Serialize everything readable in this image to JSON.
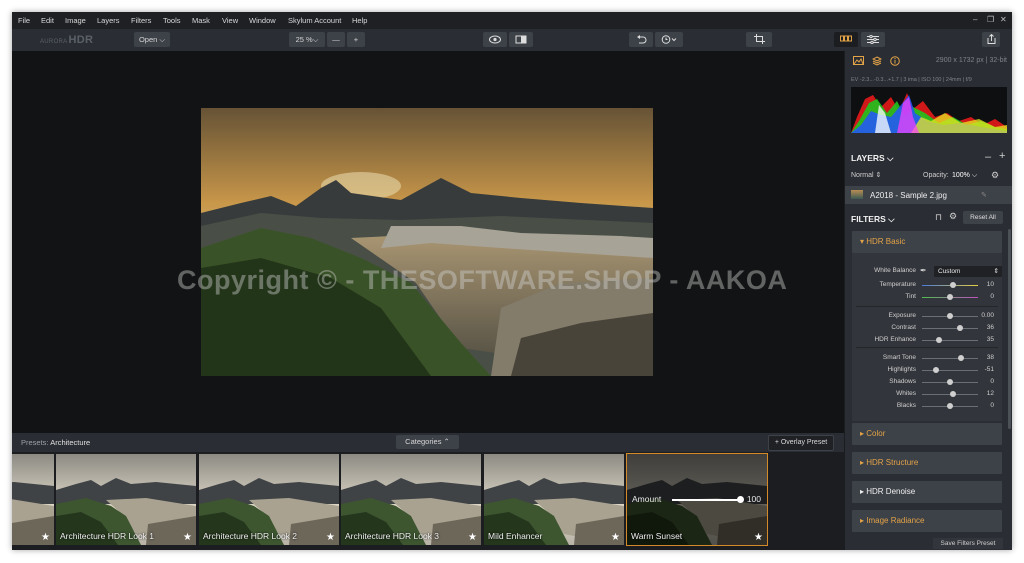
{
  "menubar": {
    "items": [
      "File",
      "Edit",
      "Image",
      "Layers",
      "Filters",
      "Tools",
      "Mask",
      "View",
      "Window",
      "Skylum Account",
      "Help"
    ],
    "window_controls": {
      "minimize": "–",
      "restore": "❐",
      "close": "✕"
    }
  },
  "toolbar": {
    "logo_prefix": "AURORA",
    "logo_main": "HDR",
    "open_label": "Open ⌵",
    "zoom_value": "25 %⌵",
    "zoom_out": "—",
    "zoom_in": "+",
    "icons": [
      "eye-icon",
      "compare-icon",
      "undo-icon",
      "history-icon",
      "crop-icon",
      "presets-view-icon",
      "adjustments-view-icon",
      "share-icon"
    ]
  },
  "canvas": {
    "watermark": "Copyright © - THESOFTWARE.SHOP - AAKOA"
  },
  "presets": {
    "label_prefix": "Presets:",
    "category": "Architecture",
    "categories_button": "Categories ⌃",
    "overlay_button": "+ Overlay Preset",
    "items": [
      {
        "label": ""
      },
      {
        "label": "Architecture HDR Look 1"
      },
      {
        "label": "Architecture HDR Look 2"
      },
      {
        "label": "Architecture HDR Look 3"
      },
      {
        "label": "Mild Enhancer"
      },
      {
        "label": "Warm Sunset"
      }
    ],
    "amount_label": "Amount",
    "amount_value": "100",
    "amount_fraction": 1.0
  },
  "panel": {
    "image_size": "2900 x 1732 px  |  32-bit",
    "exif": "EV -2.3...-0.3...+1.7  |  3 ima  |  ISO 100  |  24mm  |  f/9",
    "layers_title": "LAYERS ⌵",
    "blend_mode": "Normal ⇕",
    "opacity_label": "Opacity:",
    "opacity_value": "100% ⌵",
    "layer_name": "A2018 - Sample 2.jpg",
    "filters_title": "FILTERS ⌵",
    "reset_all": "Reset All",
    "hdr_basic": "HDR Basic",
    "white_balance_label": "White Balance",
    "white_balance_value": "Custom",
    "sliders_a": [
      {
        "label": "Temperature",
        "value": "10",
        "pos": 0.55
      },
      {
        "label": "Tint",
        "value": "0",
        "pos": 0.5
      }
    ],
    "sliders_b": [
      {
        "label": "Exposure",
        "value": "0.00",
        "pos": 0.5
      },
      {
        "label": "Contrast",
        "value": "36",
        "pos": 0.68
      },
      {
        "label": "HDR Enhance",
        "value": "35",
        "pos": 0.3
      }
    ],
    "sliders_c": [
      {
        "label": "Smart Tone",
        "value": "38",
        "pos": 0.69
      },
      {
        "label": "Highlights",
        "value": "-51",
        "pos": 0.25
      },
      {
        "label": "Shadows",
        "value": "0",
        "pos": 0.5
      },
      {
        "label": "Whites",
        "value": "12",
        "pos": 0.56
      },
      {
        "label": "Blacks",
        "value": "0",
        "pos": 0.5
      }
    ],
    "groups": [
      "Color",
      "HDR Structure",
      "HDR Denoise",
      "Image Radiance"
    ],
    "save_filters": "Save Filters Preset"
  }
}
